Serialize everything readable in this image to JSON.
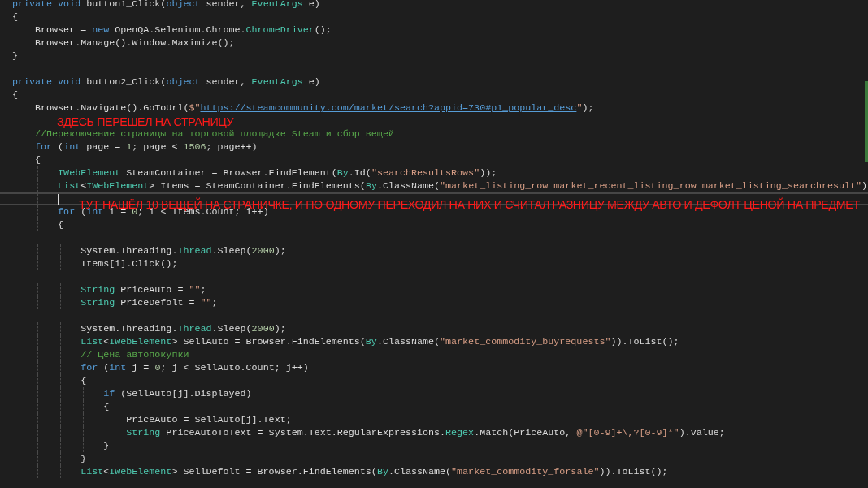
{
  "editor": {
    "blocks": [
      {
        "lines": [
          {
            "tokens": [
              {
                "kind": "kw",
                "text": "private "
              },
              {
                "kind": "kw",
                "text": "void"
              },
              {
                "kind": "plain",
                "text": " button1_Click("
              },
              {
                "kind": "kw",
                "text": "object"
              },
              {
                "kind": "plain",
                "text": " sender, "
              },
              {
                "kind": "type",
                "text": "EventArgs"
              },
              {
                "kind": "plain",
                "text": " e)"
              }
            ]
          },
          {
            "tokens": [
              {
                "kind": "plain",
                "text": "{"
              }
            ]
          },
          {
            "tokens": [
              {
                "kind": "plain",
                "text": "    Browser = "
              },
              {
                "kind": "kw",
                "text": "new"
              },
              {
                "kind": "plain",
                "text": " OpenQA.Selenium.Chrome."
              },
              {
                "kind": "type",
                "text": "ChromeDriver"
              },
              {
                "kind": "plain",
                "text": "();"
              }
            ]
          },
          {
            "tokens": [
              {
                "kind": "plain",
                "text": "    Browser.Manage().Window.Maximize();"
              }
            ]
          },
          {
            "tokens": [
              {
                "kind": "plain",
                "text": "}"
              }
            ]
          }
        ]
      },
      {
        "lines": [
          {
            "tokens": [
              {
                "kind": "kw",
                "text": "private "
              },
              {
                "kind": "kw",
                "text": "void"
              },
              {
                "kind": "plain",
                "text": " button2_Click("
              },
              {
                "kind": "kw",
                "text": "object"
              },
              {
                "kind": "plain",
                "text": " sender, "
              },
              {
                "kind": "type",
                "text": "EventArgs"
              },
              {
                "kind": "plain",
                "text": " e)"
              }
            ]
          },
          {
            "tokens": [
              {
                "kind": "plain",
                "text": "{"
              }
            ]
          },
          {
            "tokens": [
              {
                "kind": "plain",
                "text": "    Browser.Navigate().GoToUrl("
              },
              {
                "kind": "str",
                "text": "$\""
              },
              {
                "kind": "url",
                "text": "https://steamcommunity.com/market/search?appid=730#p1_popular_desc"
              },
              {
                "kind": "str",
                "text": "\""
              },
              {
                "kind": "plain",
                "text": ");"
              }
            ]
          }
        ]
      },
      {
        "lines": [
          {
            "tokens": [
              {
                "kind": "cm",
                "text": "    //Переключение страницы на торговой площадке Steam и сбор вещей"
              }
            ]
          },
          {
            "tokens": [
              {
                "kind": "kw",
                "text": "    for"
              },
              {
                "kind": "plain",
                "text": " ("
              },
              {
                "kind": "kw",
                "text": "int"
              },
              {
                "kind": "plain",
                "text": " page = "
              },
              {
                "kind": "num",
                "text": "1"
              },
              {
                "kind": "plain",
                "text": "; page < "
              },
              {
                "kind": "num",
                "text": "1506"
              },
              {
                "kind": "plain",
                "text": "; page++)"
              }
            ]
          },
          {
            "tokens": [
              {
                "kind": "plain",
                "text": "    {"
              }
            ]
          },
          {
            "tokens": [
              {
                "kind": "type",
                "text": "        IWebElement"
              },
              {
                "kind": "plain",
                "text": " SteamContainer = Browser.FindElement("
              },
              {
                "kind": "type",
                "text": "By"
              },
              {
                "kind": "plain",
                "text": ".Id("
              },
              {
                "kind": "str",
                "text": "\"searchResultsRows\""
              },
              {
                "kind": "plain",
                "text": "));"
              }
            ]
          },
          {
            "tokens": [
              {
                "kind": "type",
                "text": "        List"
              },
              {
                "kind": "plain",
                "text": "<"
              },
              {
                "kind": "type",
                "text": "IWebElement"
              },
              {
                "kind": "plain",
                "text": "> Items = SteamContainer.FindElements("
              },
              {
                "kind": "type",
                "text": "By"
              },
              {
                "kind": "plain",
                "text": ".ClassName("
              },
              {
                "kind": "str",
                "text": "\"market_listing_row market_recent_listing_row market_listing_searchresult\""
              },
              {
                "kind": "plain",
                "text": ")"
              }
            ]
          },
          {
            "current": true
          },
          {
            "tokens": [
              {
                "kind": "kw",
                "text": "        for"
              },
              {
                "kind": "plain",
                "text": " ("
              },
              {
                "kind": "kw",
                "text": "int"
              },
              {
                "kind": "plain",
                "text": " i = "
              },
              {
                "kind": "num",
                "text": "0"
              },
              {
                "kind": "plain",
                "text": "; i < Items.Count; i++)"
              }
            ]
          },
          {
            "tokens": [
              {
                "kind": "plain",
                "text": "        {"
              }
            ]
          }
        ]
      },
      {
        "lines": [
          {
            "tokens": [
              {
                "kind": "plain",
                "text": "            System.Threading."
              },
              {
                "kind": "type",
                "text": "Thread"
              },
              {
                "kind": "plain",
                "text": ".Sleep("
              },
              {
                "kind": "num",
                "text": "2000"
              },
              {
                "kind": "plain",
                "text": ");"
              }
            ]
          },
          {
            "tokens": [
              {
                "kind": "plain",
                "text": "            Items[i].Click();"
              }
            ]
          }
        ]
      },
      {
        "lines": [
          {
            "tokens": [
              {
                "kind": "type",
                "text": "            String"
              },
              {
                "kind": "plain",
                "text": " PriceAuto = "
              },
              {
                "kind": "str",
                "text": "\"\""
              },
              {
                "kind": "plain",
                "text": ";"
              }
            ]
          },
          {
            "tokens": [
              {
                "kind": "type",
                "text": "            String"
              },
              {
                "kind": "plain",
                "text": " PriceDefolt = "
              },
              {
                "kind": "str",
                "text": "\"\""
              },
              {
                "kind": "plain",
                "text": ";"
              }
            ]
          }
        ]
      },
      {
        "lines": [
          {
            "tokens": [
              {
                "kind": "plain",
                "text": "            System.Threading."
              },
              {
                "kind": "type",
                "text": "Thread"
              },
              {
                "kind": "plain",
                "text": ".Sleep("
              },
              {
                "kind": "num",
                "text": "2000"
              },
              {
                "kind": "plain",
                "text": ");"
              }
            ]
          },
          {
            "tokens": [
              {
                "kind": "type",
                "text": "            List"
              },
              {
                "kind": "plain",
                "text": "<"
              },
              {
                "kind": "type",
                "text": "IWebElement"
              },
              {
                "kind": "plain",
                "text": "> SellAuto = Browser.FindElements("
              },
              {
                "kind": "type",
                "text": "By"
              },
              {
                "kind": "plain",
                "text": ".ClassName("
              },
              {
                "kind": "str",
                "text": "\"market_commodity_buyrequests\""
              },
              {
                "kind": "plain",
                "text": ")).ToList();"
              }
            ]
          },
          {
            "tokens": [
              {
                "kind": "cm",
                "text": "            // Цена автопокупки"
              }
            ]
          },
          {
            "tokens": [
              {
                "kind": "kw",
                "text": "            for"
              },
              {
                "kind": "plain",
                "text": " ("
              },
              {
                "kind": "kw",
                "text": "int"
              },
              {
                "kind": "plain",
                "text": " j = "
              },
              {
                "kind": "num",
                "text": "0"
              },
              {
                "kind": "plain",
                "text": "; j < SellAuto.Count; j++)"
              }
            ]
          },
          {
            "tokens": [
              {
                "kind": "plain",
                "text": "            {"
              }
            ]
          },
          {
            "tokens": [
              {
                "kind": "kw",
                "text": "                if"
              },
              {
                "kind": "plain",
                "text": " (SellAuto[j].Displayed)"
              }
            ]
          },
          {
            "tokens": [
              {
                "kind": "plain",
                "text": "                {"
              }
            ]
          },
          {
            "tokens": [
              {
                "kind": "plain",
                "text": "                    PriceAuto = SellAuto[j].Text;"
              }
            ]
          },
          {
            "tokens": [
              {
                "kind": "type",
                "text": "                    String"
              },
              {
                "kind": "plain",
                "text": " PriceAutoToText = System.Text.RegularExpressions."
              },
              {
                "kind": "type",
                "text": "Regex"
              },
              {
                "kind": "plain",
                "text": ".Match(PriceAuto, "
              },
              {
                "kind": "str",
                "text": "@\"[0-9]+\\,?[0-9]*\""
              },
              {
                "kind": "plain",
                "text": ").Value;"
              }
            ]
          },
          {
            "tokens": [
              {
                "kind": "plain",
                "text": "                }"
              }
            ]
          },
          {
            "tokens": [
              {
                "kind": "plain",
                "text": "            }"
              }
            ]
          },
          {
            "tokens": [
              {
                "kind": "type",
                "text": "            List"
              },
              {
                "kind": "plain",
                "text": "<"
              },
              {
                "kind": "type",
                "text": "IWebElement"
              },
              {
                "kind": "plain",
                "text": "> SellDefolt = Browser.FindElements("
              },
              {
                "kind": "type",
                "text": "By"
              },
              {
                "kind": "plain",
                "text": ".ClassName("
              },
              {
                "kind": "str",
                "text": "\"market_commodity_forsale\""
              },
              {
                "kind": "plain",
                "text": ")).ToList();"
              }
            ]
          }
        ]
      }
    ]
  },
  "annotations": [
    {
      "text": "ЗДЕСЬ ПЕРЕШЕЛ НА СТРАНИЦУ"
    },
    {
      "text": "ТУТ НАШЁЛ 10 ВЕЩЕЙ НА СТРАНИЧКЕ, И ПО ОДНОМУ ПЕРЕХОДИЛ НА НИХ И СЧИТАЛ РАЗНИЦУ МЕЖДУ АВТО И ДЕФОЛТ ЦЕНОЙ НА ПРЕДМЕТ"
    }
  ]
}
